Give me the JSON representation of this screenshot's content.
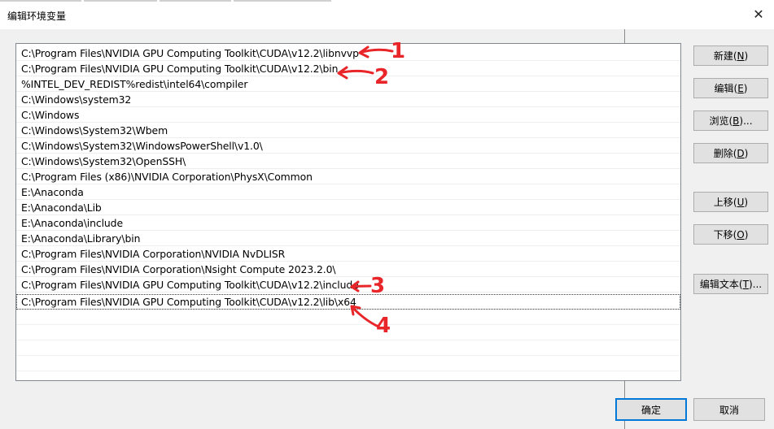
{
  "window": {
    "title": "编辑环境变量",
    "close_glyph": "✕"
  },
  "paths": [
    "C:\\Program Files\\NVIDIA GPU Computing Toolkit\\CUDA\\v12.2\\libnvvp",
    "C:\\Program Files\\NVIDIA GPU Computing Toolkit\\CUDA\\v12.2\\bin",
    "%INTEL_DEV_REDIST%redist\\intel64\\compiler",
    "C:\\Windows\\system32",
    "C:\\Windows",
    "C:\\Windows\\System32\\Wbem",
    "C:\\Windows\\System32\\WindowsPowerShell\\v1.0\\",
    "C:\\Windows\\System32\\OpenSSH\\",
    "C:\\Program Files (x86)\\NVIDIA Corporation\\PhysX\\Common",
    "E:\\Anaconda",
    "E:\\Anaconda\\Lib",
    "E:\\Anaconda\\include",
    "E:\\Anaconda\\Library\\bin",
    "C:\\Program Files\\NVIDIA Corporation\\NVIDIA NvDLISR",
    "C:\\Program Files\\NVIDIA Corporation\\Nsight Compute 2023.2.0\\",
    "C:\\Program Files\\NVIDIA GPU Computing Toolkit\\CUDA\\v12.2\\include",
    "C:\\Program Files\\NVIDIA GPU Computing Toolkit\\CUDA\\v12.2\\lib\\x64"
  ],
  "side_buttons": {
    "new": {
      "label": "新建(",
      "mnemonic": "N",
      "suffix": ")"
    },
    "edit": {
      "label": "编辑(",
      "mnemonic": "E",
      "suffix": ")"
    },
    "browse": {
      "label": "浏览(",
      "mnemonic": "B",
      "suffix": ")..."
    },
    "delete": {
      "label": "删除(",
      "mnemonic": "D",
      "suffix": ")"
    },
    "move_up": {
      "label": "上移(",
      "mnemonic": "U",
      "suffix": ")"
    },
    "move_down": {
      "label": "下移(",
      "mnemonic": "O",
      "suffix": ")"
    },
    "edit_text": {
      "label": "编辑文本(",
      "mnemonic": "T",
      "suffix": ")..."
    }
  },
  "footer": {
    "ok_label": "确定",
    "cancel_label": "取消"
  },
  "annotations": {
    "mark1": "1",
    "mark2": "2",
    "mark3": "3",
    "mark4": "4",
    "color": "#e8262a"
  }
}
